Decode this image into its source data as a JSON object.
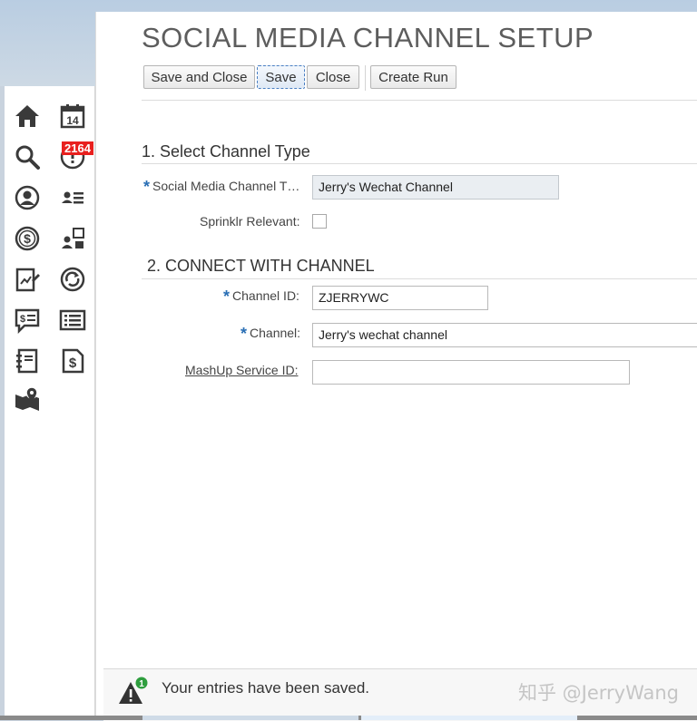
{
  "page": {
    "title": "SOCIAL MEDIA CHANNEL SETUP"
  },
  "toolbar": {
    "save_and_close": "Save and Close",
    "save": "Save",
    "close": "Close",
    "create_run": "Create Run"
  },
  "sidebar": {
    "icons": [
      "home-icon",
      "calendar-icon",
      "search-icon",
      "alert-icon",
      "account-icon",
      "contacts-list-icon",
      "dollar-icon",
      "org-chart-icon",
      "report-icon",
      "refresh-icon",
      "quote-icon",
      "list-icon",
      "notebook-icon",
      "invoice-icon",
      "map-pin-icon"
    ],
    "calendar_day": "14",
    "alert_badge": "2164"
  },
  "section1": {
    "title": "1. Select Channel Type",
    "channel_type_label": "Social Media Channel T…",
    "channel_type_value": "Jerry's Wechat Channel",
    "sprinklr_label": "Sprinklr Relevant:",
    "sprinklr_checked": false
  },
  "section2": {
    "title": "2. CONNECT WITH CHANNEL",
    "channel_id_label": "Channel ID:",
    "channel_id_value": "ZJERRYWC",
    "channel_label": "Channel:",
    "channel_value": "Jerry's wechat channel",
    "mashup_label": "MashUp Service ID:",
    "mashup_value": ""
  },
  "toast": {
    "message": "Your entries have been saved.",
    "count": "1",
    "watermark": "知乎 @JerryWang"
  },
  "colors": {
    "required_marker": "#2a6fb5",
    "badge": "#e8201e",
    "readonly_field": "#eaeef2"
  }
}
